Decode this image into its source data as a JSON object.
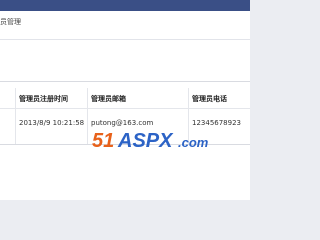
{
  "page": {
    "title": "员管理"
  },
  "table": {
    "headers": [
      "管理员注册时间",
      "管理员邮箱",
      "管理员电话"
    ],
    "rows": [
      [
        "2013/8/9 10:21:58",
        "putong@163.com",
        "12345678923"
      ]
    ]
  },
  "watermark": {
    "text_number": "51",
    "text_brand": "ASPX",
    "text_suffix": ".com",
    "colors": {
      "number": "#e8611a",
      "brand": "#2c63c6",
      "suffix": "#2c63c6"
    }
  }
}
